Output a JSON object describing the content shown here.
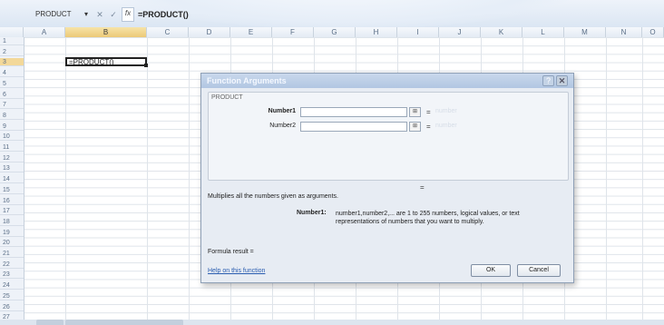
{
  "formula_bar": {
    "name_box": "PRODUCT",
    "dropdown_glyph": "▾",
    "cancel_glyph": "✕",
    "enter_glyph": "✓",
    "fx_label": "fx",
    "formula": "=PRODUCT()"
  },
  "columns": [
    "A",
    "B",
    "C",
    "D",
    "E",
    "F",
    "G",
    "H",
    "I",
    "J",
    "K",
    "L",
    "M",
    "N",
    "O"
  ],
  "rows": [
    "1",
    "2",
    "3",
    "4",
    "5",
    "6",
    "7",
    "8",
    "9",
    "10",
    "11",
    "12",
    "13",
    "14",
    "15",
    "16",
    "17",
    "18",
    "19",
    "20",
    "21",
    "22",
    "23",
    "24",
    "25",
    "26",
    "27"
  ],
  "active_cell": {
    "ref": "B3",
    "value": "=PRODUCT()"
  },
  "dialog": {
    "title": "Function Arguments",
    "help_glyph": "?",
    "close_glyph": "✕",
    "group_label": "PRODUCT",
    "args": [
      {
        "label": "Number1",
        "eq": "=",
        "type": "number",
        "collapse": "⊞"
      },
      {
        "label": "Number2",
        "eq": "=",
        "type": "number",
        "collapse": "⊞"
      }
    ],
    "result_eq": "=",
    "description": "Multiplies all the numbers given as arguments.",
    "arg_desc_label": "Number1:",
    "arg_desc_text": "number1,number2,... are 1 to 255 numbers, logical values, or text representations of numbers that you want to multiply.",
    "formula_result": "Formula result =",
    "help_link": "Help on this function",
    "ok": "OK",
    "cancel": "Cancel"
  }
}
